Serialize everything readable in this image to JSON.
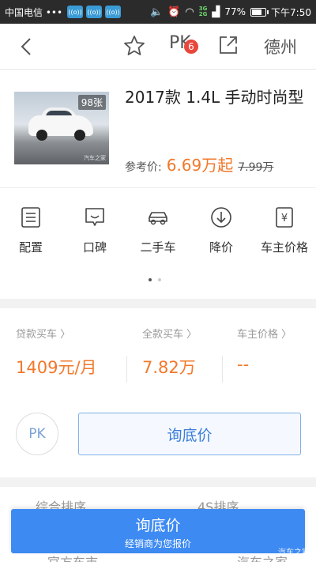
{
  "status_bar": {
    "carrier": "中国电信 •••",
    "chips": [
      "((o))",
      "((o))",
      "((o))"
    ],
    "network": [
      "3G",
      "2G"
    ],
    "battery_percent": 77,
    "battery_text": "77%",
    "time": "下午7:50"
  },
  "nav": {
    "pk_label": "PK",
    "pk_badge": "6",
    "city": "德州"
  },
  "car": {
    "photo_count": "98张",
    "watermark": "汽车之家",
    "title": "2017款 1.4L 手动时尚型",
    "price_label": "参考价:",
    "price": "6.69万起",
    "price_old": "7.99万"
  },
  "menu": {
    "items": [
      {
        "label": "配置",
        "icon": "config-icon"
      },
      {
        "label": "口碑",
        "icon": "review-icon"
      },
      {
        "label": "二手车",
        "icon": "used-car-icon"
      },
      {
        "label": "降价",
        "icon": "price-drop-icon"
      },
      {
        "label": "车主价格",
        "icon": "owner-price-icon"
      }
    ],
    "page_index": 0,
    "page_count": 2
  },
  "finance": {
    "loan_label": "贷款买车 〉",
    "loan_value": "1409元/月",
    "full_label": "全款买车 〉",
    "full_value": "7.82万",
    "owner_label": "车主价格 〉",
    "owner_value": "--"
  },
  "actions": {
    "pk_label": "PK",
    "inquiry_label": "询底价"
  },
  "behind": {
    "left_text": "综合排序",
    "right_text": "4S排序",
    "left_text2": "官方车市",
    "right_text2": "汽车之家"
  },
  "bottom_button": {
    "main": "询底价",
    "sub": "经销商为您报价"
  },
  "corner_watermark": "汽车之家",
  "colors": {
    "accent_orange": "#f2782a",
    "primary_blue": "#3d8af2",
    "badge_red": "#e8473c"
  }
}
